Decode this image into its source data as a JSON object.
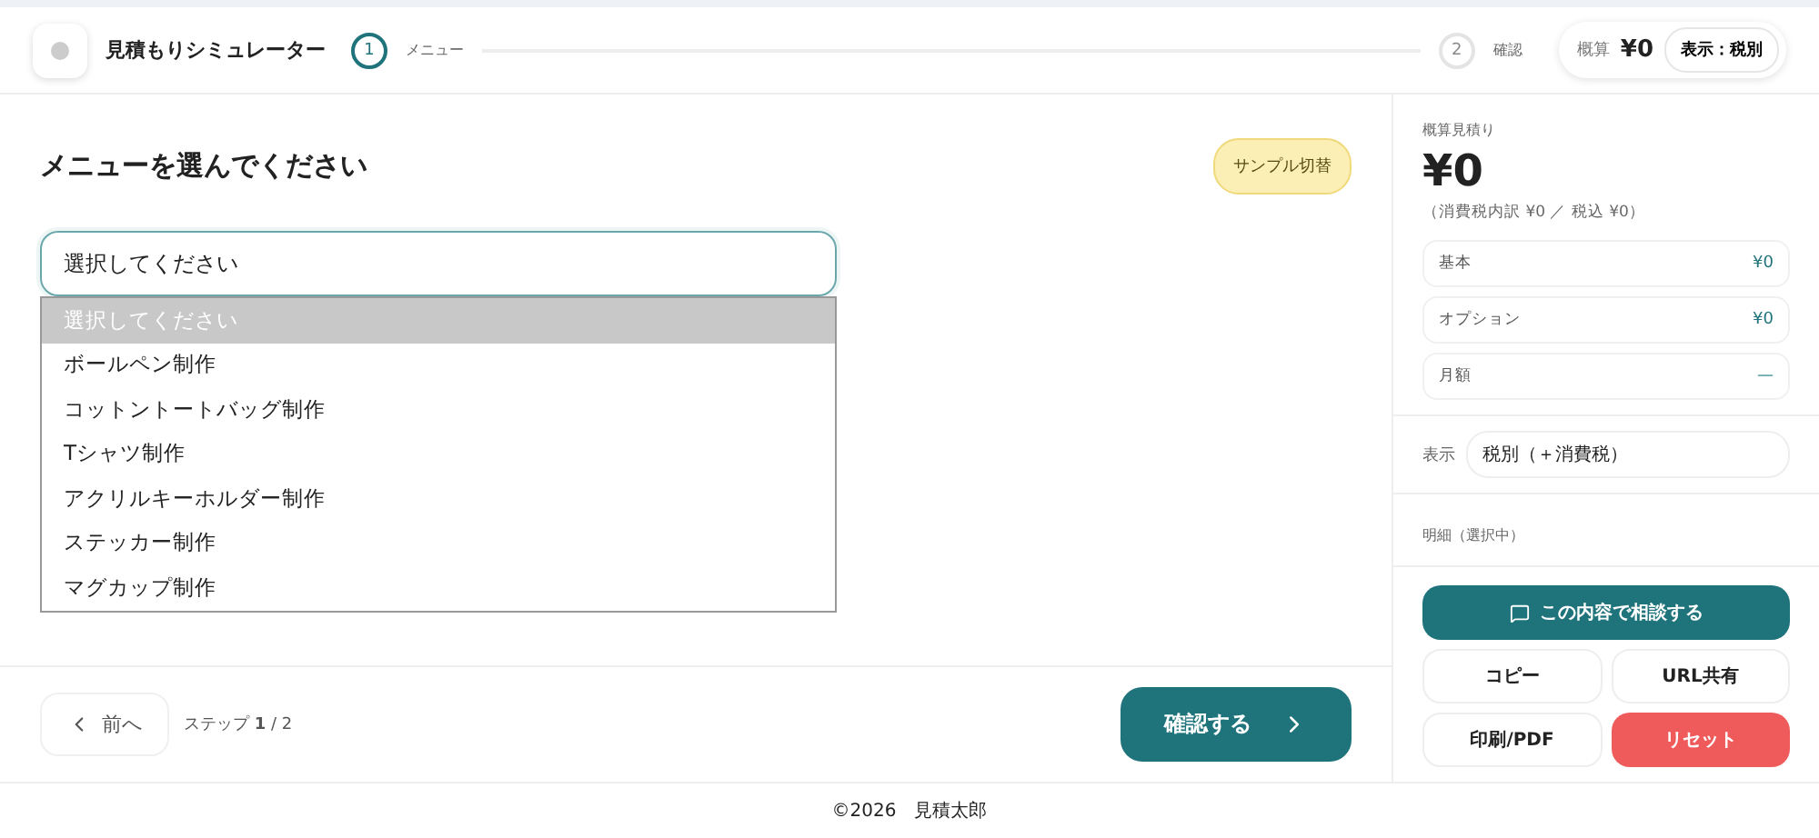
{
  "header": {
    "title": "見積もりシミュレーター",
    "steps": [
      {
        "number": "1",
        "label": "メニュー",
        "selected": true
      },
      {
        "number": "2",
        "label": "確認",
        "selected": false
      }
    ],
    "summary": {
      "label": "概算",
      "amount": "¥0",
      "display_toggle": "表示：税別"
    }
  },
  "main": {
    "heading": "メニューを選んでください",
    "sample_button": "サンプル切替",
    "select": {
      "value": "選択してください",
      "expanded": true,
      "options": [
        {
          "label": "選択してください",
          "selected": true
        },
        {
          "label": "ボールペン制作",
          "selected": false
        },
        {
          "label": "コットントートバッグ制作",
          "selected": false
        },
        {
          "label": "Tシャツ制作",
          "selected": false
        },
        {
          "label": "アクリルキーホルダー制作",
          "selected": false
        },
        {
          "label": "ステッカー制作",
          "selected": false
        },
        {
          "label": "マグカップ制作",
          "selected": false
        }
      ]
    },
    "prev_button": "前へ",
    "step_prefix": "ステップ",
    "step_current": "1",
    "step_total": "/ 2",
    "confirm_button": "確認する"
  },
  "sidebar": {
    "label": "概算見積り",
    "total": "¥0",
    "tax_note": "（消費税内訳 ¥0 ／ 税込 ¥0）",
    "lines": [
      {
        "label": "基本",
        "value": "¥0",
        "kind": "amount"
      },
      {
        "label": "オプション",
        "value": "¥0",
        "kind": "amount"
      },
      {
        "label": "月額",
        "value": "—",
        "kind": "dash"
      }
    ],
    "display_label": "表示",
    "display_value": "税別（＋消費税）",
    "details_label": "明細（選択中）",
    "consult_button": "この内容で相談する",
    "buttons": [
      {
        "label": "コピー",
        "kind": "plain"
      },
      {
        "label": "URL共有",
        "kind": "plain"
      },
      {
        "label": "印刷/PDF",
        "kind": "plain"
      },
      {
        "label": "リセット",
        "kind": "danger"
      }
    ]
  },
  "footer": "©2026　見積太郎"
}
